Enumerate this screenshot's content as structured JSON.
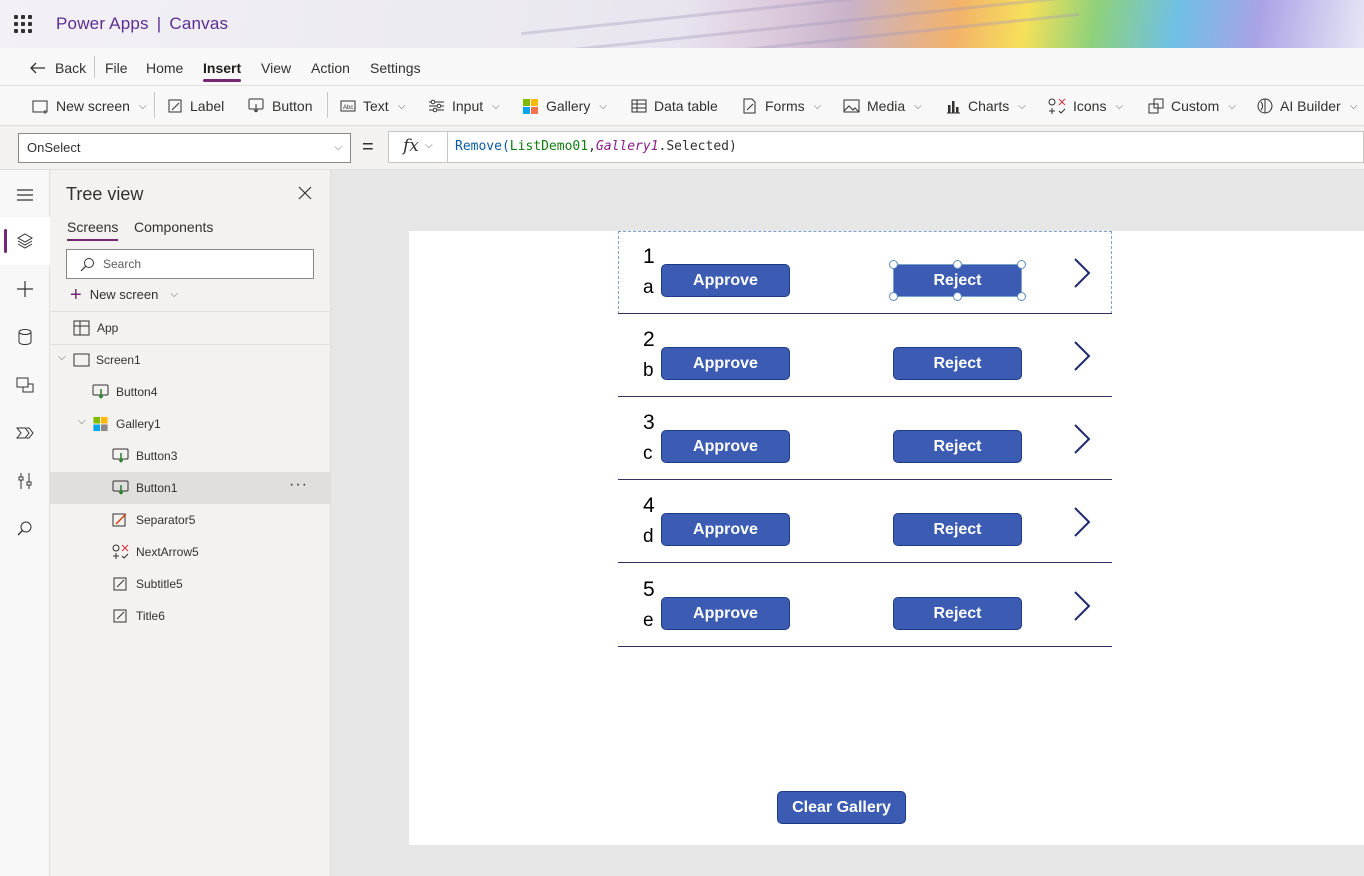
{
  "header": {
    "app_name": "Power Apps",
    "separator": "|",
    "app_type": "Canvas"
  },
  "menu": {
    "back": "Back",
    "items": [
      "File",
      "Home",
      "Insert",
      "View",
      "Action",
      "Settings"
    ],
    "active": "Insert"
  },
  "ribbon": {
    "new_screen": "New screen",
    "label": "Label",
    "button": "Button",
    "text": "Text",
    "input": "Input",
    "gallery": "Gallery",
    "data_table": "Data table",
    "forms": "Forms",
    "media": "Media",
    "charts": "Charts",
    "icons": "Icons",
    "custom": "Custom",
    "ai_builder": "AI Builder"
  },
  "formula_bar": {
    "property": "OnSelect",
    "equals": "=",
    "fx": "fx",
    "formula_fn": "Remove(",
    "formula_ds": "ListDemo01",
    "formula_comma": ",",
    "formula_ctl": "Gallery1",
    "formula_rest": ".Selected)"
  },
  "tree_view": {
    "title": "Tree view",
    "tabs": [
      "Screens",
      "Components"
    ],
    "search_placeholder": "Search",
    "new_screen": "New screen",
    "nodes": {
      "app": "App",
      "screen1": "Screen1",
      "button4": "Button4",
      "gallery1": "Gallery1",
      "button3": "Button3",
      "button1": "Button1",
      "separator5": "Separator5",
      "nextarrow5": "NextArrow5",
      "subtitle5": "Subtitle5",
      "title6": "Title6"
    },
    "more": "···"
  },
  "gallery": {
    "rows": [
      {
        "title": "1",
        "subtitle": "a",
        "approve": "Approve",
        "reject": "Reject"
      },
      {
        "title": "2",
        "subtitle": "b",
        "approve": "Approve",
        "reject": "Reject"
      },
      {
        "title": "3",
        "subtitle": "c",
        "approve": "Approve",
        "reject": "Reject"
      },
      {
        "title": "4",
        "subtitle": "d",
        "approve": "Approve",
        "reject": "Reject"
      },
      {
        "title": "5",
        "subtitle": "e",
        "approve": "Approve",
        "reject": "Reject"
      }
    ]
  },
  "clear_button": "Clear Gallery",
  "colors": {
    "brand": "#742774",
    "button": "#3b5cb2",
    "button_border": "#1e3b86"
  }
}
